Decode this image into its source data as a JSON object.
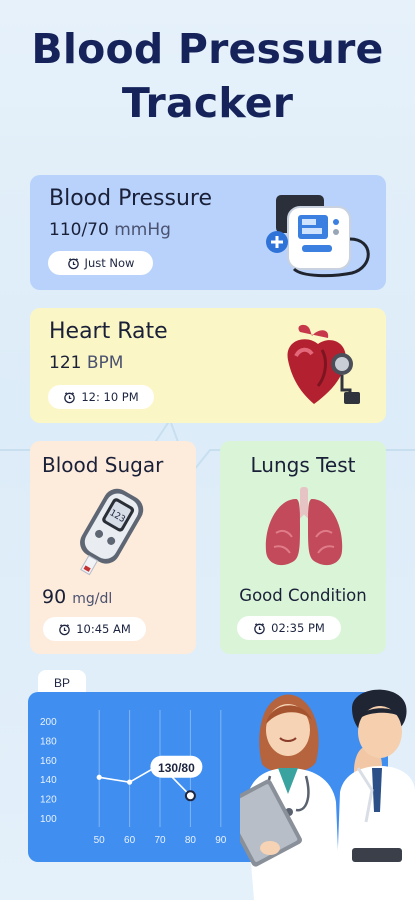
{
  "title": {
    "line1": "Blood Pressure",
    "line2": "Tracker"
  },
  "cards": {
    "blood_pressure": {
      "title": "Blood Pressure",
      "value": "110/70",
      "unit": "mmHg",
      "time": "Just Now",
      "icon": "blood-pressure-monitor-icon"
    },
    "heart_rate": {
      "title": "Heart Rate",
      "value": "121",
      "unit": "BPM",
      "time": "12: 10 PM",
      "icon": "heart-stethoscope-icon"
    },
    "blood_sugar": {
      "title": "Blood Sugar",
      "value": "90",
      "unit": "mg/dl",
      "time": "10:45 AM",
      "icon": "glucometer-icon",
      "meter_reading": "123"
    },
    "lungs_test": {
      "title": "Lungs Test",
      "status": "Good Condition",
      "time": "02:35 PM",
      "icon": "lungs-icon"
    }
  },
  "chart_tab": "BP",
  "chart_data": {
    "type": "line",
    "x": [
      50,
      60,
      70,
      80
    ],
    "y": [
      142,
      137,
      155,
      123
    ],
    "x_ticks": [
      "50",
      "60",
      "70",
      "80",
      "90"
    ],
    "y_ticks": [
      "200",
      "180",
      "160",
      "140",
      "120",
      "100"
    ],
    "xlim": [
      45,
      95
    ],
    "ylim": [
      95,
      205
    ],
    "annotation": {
      "label": "130/80",
      "x": 80,
      "y": 123
    },
    "grid": "vertical",
    "colors": {
      "background": "#3f8ef0",
      "line": "#ffffff"
    }
  },
  "colors": {
    "title": "#15235a",
    "bp_card": "#b8d2fb",
    "hr_card": "#fbf6c6",
    "bs_card": "#fdebdc",
    "lt_card": "#d9f4d7"
  }
}
